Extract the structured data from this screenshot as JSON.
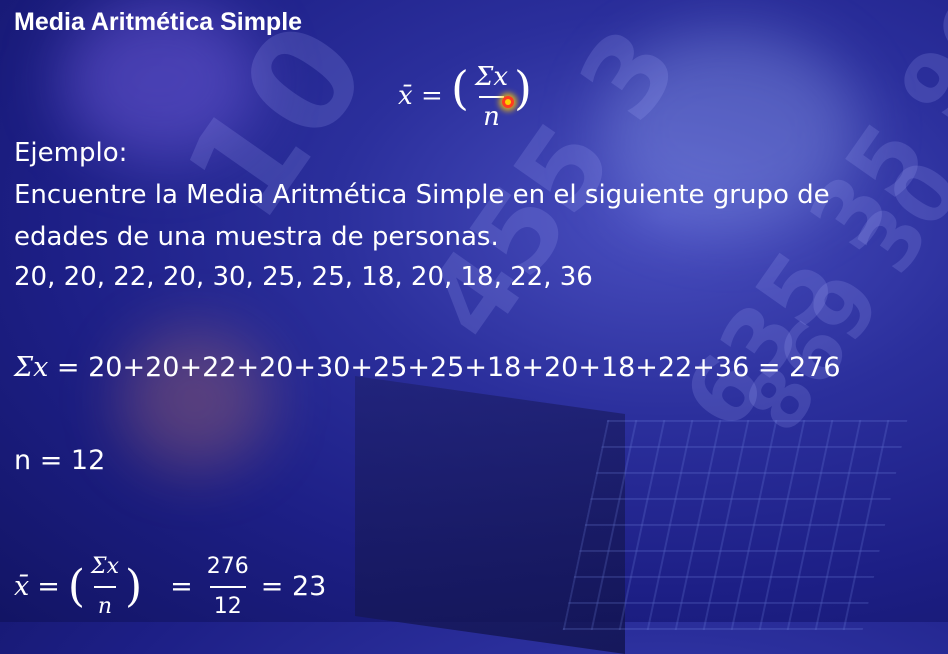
{
  "title": "Media Aritmética Simple",
  "formula": {
    "lhs": "x̄",
    "eq": "=",
    "num": "Σx",
    "den": "n"
  },
  "example_label": "Ejemplo:",
  "statement": {
    "line1": "Encuentre la Media Aritmética Simple en el siguiente grupo de",
    "line2": "edades de una muestra de personas.",
    "values": "20, 20, 22, 20, 30, 25, 25, 18, 20, 18, 22, 36"
  },
  "sum_line": {
    "symbol": "Σx",
    "expression": "= 20+20+22+20+30+25+25+18+20+18+22+36 = 276"
  },
  "n_line": "n = 12",
  "result": {
    "lhs": "x̄",
    "eq": "=",
    "num": "Σx",
    "den": "n",
    "eq2": "=",
    "frac_num": "276",
    "frac_den": "12",
    "final": "= 23"
  }
}
